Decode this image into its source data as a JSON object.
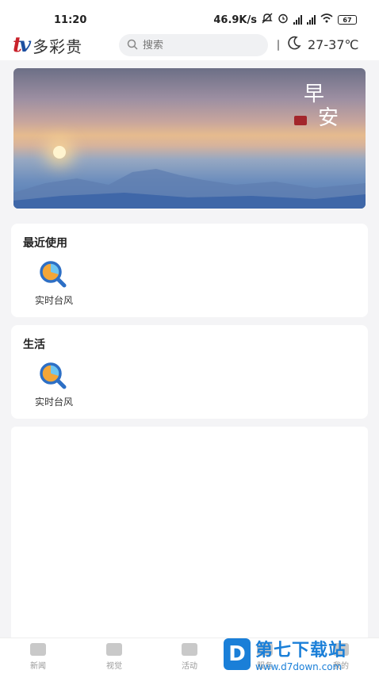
{
  "status_bar": {
    "time": "11:20",
    "net_speed": "46.9K/s",
    "battery": "67"
  },
  "header": {
    "logo_mark": "tv",
    "logo_text": "多彩贵",
    "search_placeholder": "搜索",
    "weather_temp": "27-37℃",
    "icons": {
      "search": "search-icon",
      "scan": "scan-icon",
      "weather": "moon-icon"
    }
  },
  "banner": {
    "greeting_line1": "早",
    "greeting_line2": "安"
  },
  "sections": {
    "recent": {
      "title": "最近使用",
      "items": [
        {
          "label": "实时台风",
          "icon": "typhoon-search-icon"
        }
      ]
    },
    "life": {
      "title": "生活",
      "items": [
        {
          "label": "实时台风",
          "icon": "typhoon-search-icon"
        }
      ]
    }
  },
  "tabbar": {
    "tabs": [
      {
        "label": "新闻",
        "icon": "news-icon"
      },
      {
        "label": "视觉",
        "icon": "video-icon"
      },
      {
        "label": "活动",
        "icon": "activity-icon"
      },
      {
        "label": "服务",
        "icon": "service-icon"
      },
      {
        "label": "我的",
        "icon": "profile-icon"
      }
    ]
  },
  "watermark": {
    "badge": "D",
    "title": "第七下载站",
    "url": "www.d7down.com"
  },
  "colors": {
    "accent_blue": "#1a7fd8",
    "logo_red": "#c9222b",
    "seal_red": "#a3262b"
  }
}
